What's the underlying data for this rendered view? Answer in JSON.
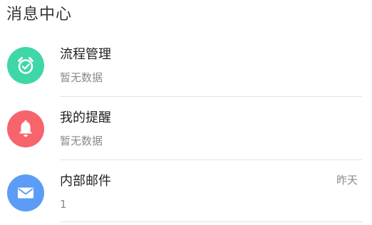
{
  "header": {
    "title": "消息中心"
  },
  "messages": [
    {
      "title": "流程管理",
      "subtitle": "暂无数据",
      "time": "",
      "icon": "alarm-clock-icon",
      "color": "#3fd6a8"
    },
    {
      "title": "我的提醒",
      "subtitle": "暂无数据",
      "time": "",
      "icon": "bell-icon",
      "color": "#f7646c"
    },
    {
      "title": "内部邮件",
      "subtitle": "1",
      "time": "昨天",
      "icon": "mail-icon",
      "color": "#5b9cf6"
    }
  ]
}
